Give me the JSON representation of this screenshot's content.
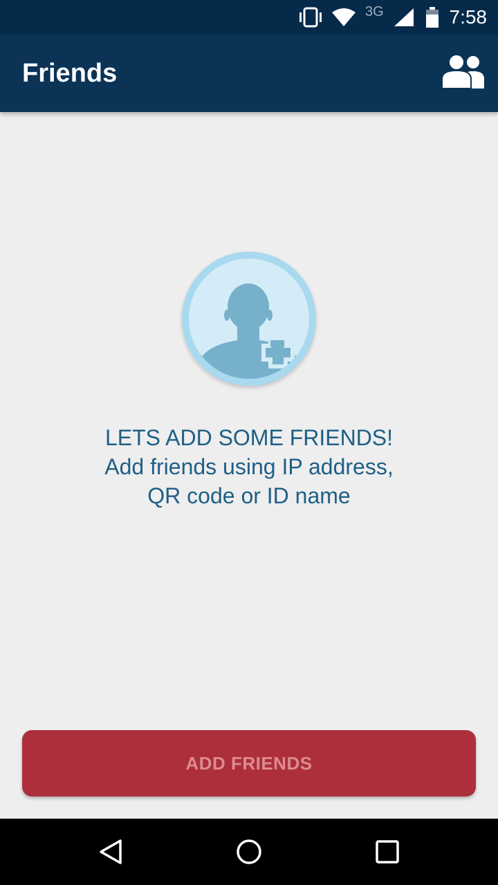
{
  "status_bar": {
    "time": "7:58",
    "network_type": "3G",
    "icons": [
      "vibrate-icon",
      "wifi-icon",
      "signal-icon",
      "battery-icon"
    ]
  },
  "app_bar": {
    "title": "Friends",
    "action_icon": "friends-icon"
  },
  "empty_state": {
    "icon": "add-person-icon",
    "line1": "LETS ADD SOME FRIENDS!",
    "line2": "Add friends using IP address,",
    "line3": "QR code or ID name"
  },
  "add_button": {
    "label": "ADD FRIENDS"
  },
  "nav_bar": {
    "icons": [
      "back-icon",
      "home-icon",
      "recents-icon"
    ]
  },
  "colors": {
    "status_bar": "#062a4a",
    "app_bar": "#0a3356",
    "background": "#eeeeee",
    "message_text": "#1e5f86",
    "button": "#ac2f3b",
    "button_text": "#dd8a91",
    "avatar_ring": "#a9d9ef",
    "avatar_fill": "#d3ecf7",
    "avatar_figure": "#77b0cb"
  }
}
